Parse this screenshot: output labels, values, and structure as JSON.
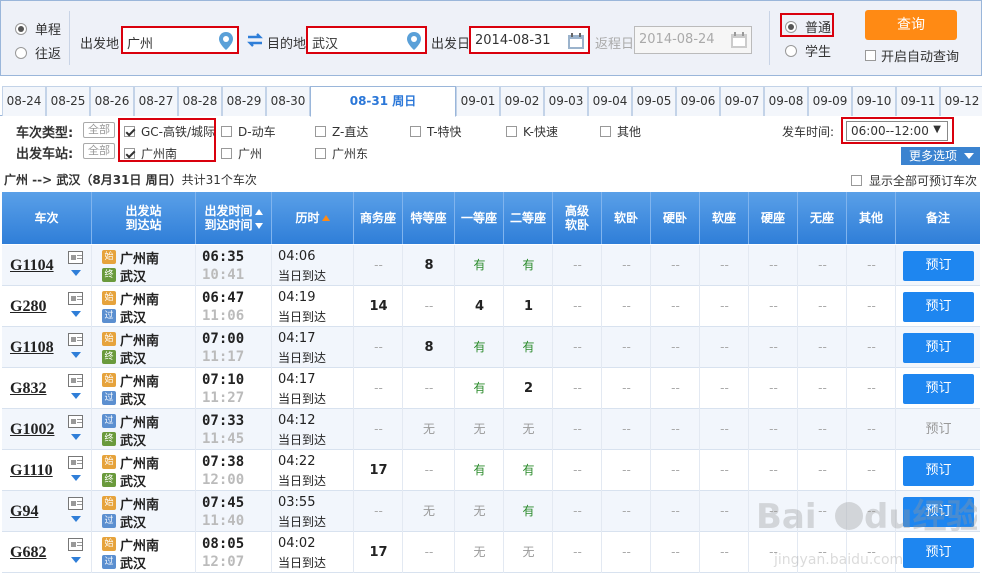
{
  "query": {
    "trip_types": [
      {
        "label": "单程",
        "selected": true
      },
      {
        "label": "往返",
        "selected": false
      }
    ],
    "from_label": "出发地",
    "from_value": "广州",
    "to_label": "目的地",
    "to_value": "武汉",
    "depart_label": "出发日",
    "depart_value": "2014-08-31",
    "return_label": "返程日",
    "return_value": "2014-08-24",
    "passenger_types": [
      {
        "label": "普通",
        "selected": true
      },
      {
        "label": "学生",
        "selected": false
      }
    ],
    "query_button": "查询",
    "auto_query_label": "开启自动查询"
  },
  "date_tabs": [
    "08-24",
    "08-25",
    "08-26",
    "08-27",
    "08-28",
    "08-29",
    "08-30",
    "08-31 周日",
    "09-01",
    "09-02",
    "09-03",
    "09-04",
    "09-05",
    "09-06",
    "09-07",
    "09-08",
    "09-09",
    "09-10",
    "09-11",
    "09-12"
  ],
  "active_date_index": 7,
  "filters": {
    "type_label": "车次类型:",
    "station_label": "出发车站:",
    "all_label": "全部",
    "types": [
      {
        "label": "GC-高铁/城际",
        "checked": true
      },
      {
        "label": "D-动车",
        "checked": false
      },
      {
        "label": "Z-直达",
        "checked": false
      },
      {
        "label": "T-特快",
        "checked": false
      },
      {
        "label": "K-快速",
        "checked": false
      },
      {
        "label": "其他",
        "checked": false
      }
    ],
    "stations": [
      {
        "label": "广州南",
        "checked": true
      },
      {
        "label": "广州",
        "checked": false
      },
      {
        "label": "广州东",
        "checked": false
      }
    ],
    "dep_time_label": "发车时间:",
    "dep_time_value": "06:00--12:00",
    "more_label": "更多选项"
  },
  "summary": {
    "route": "广州 --> 武汉（8月31日  周日）",
    "count": "共计31个车次",
    "show_all_label": "显示全部可预订车次"
  },
  "headers": {
    "train": "车次",
    "station_1": "出发站",
    "station_2": "到达站",
    "time_1": "出发时间",
    "time_2": "到达时间",
    "duration": "历时",
    "business": "商务座",
    "special": "特等座",
    "first": "一等座",
    "second": "二等座",
    "adv_soft_1": "高级",
    "adv_soft_2": "软卧",
    "soft_sleeper": "软卧",
    "hard_sleeper": "硬卧",
    "soft_seat": "软座",
    "hard_seat": "硬座",
    "no_seat": "无座",
    "other": "其他",
    "remark": "备注"
  },
  "badges": {
    "start": "始",
    "pass": "过",
    "end": "终"
  },
  "book_label": "预订",
  "rows": [
    {
      "no": "G1104",
      "from": "广州南",
      "from_type": "start",
      "to": "武汉",
      "to_type": "end",
      "dep": "06:35",
      "arr": "10:41",
      "dur": "04:06",
      "arrival_day": "当日到达",
      "seats": [
        "--",
        "8",
        "有",
        "有",
        "--",
        "--",
        "--",
        "--",
        "--",
        "--",
        "--"
      ],
      "bookable": true
    },
    {
      "no": "G280",
      "from": "广州南",
      "from_type": "start",
      "to": "武汉",
      "to_type": "pass",
      "dep": "06:47",
      "arr": "11:06",
      "dur": "04:19",
      "arrival_day": "当日到达",
      "seats": [
        "14",
        "--",
        "4",
        "1",
        "--",
        "--",
        "--",
        "--",
        "--",
        "--",
        "--"
      ],
      "bookable": true
    },
    {
      "no": "G1108",
      "from": "广州南",
      "from_type": "start",
      "to": "武汉",
      "to_type": "end",
      "dep": "07:00",
      "arr": "11:17",
      "dur": "04:17",
      "arrival_day": "当日到达",
      "seats": [
        "--",
        "8",
        "有",
        "有",
        "--",
        "--",
        "--",
        "--",
        "--",
        "--",
        "--"
      ],
      "bookable": true
    },
    {
      "no": "G832",
      "from": "广州南",
      "from_type": "start",
      "to": "武汉",
      "to_type": "pass",
      "dep": "07:10",
      "arr": "11:27",
      "dur": "04:17",
      "arrival_day": "当日到达",
      "seats": [
        "--",
        "--",
        "有",
        "2",
        "--",
        "--",
        "--",
        "--",
        "--",
        "--",
        "--"
      ],
      "bookable": true
    },
    {
      "no": "G1002",
      "from": "广州南",
      "from_type": "pass",
      "to": "武汉",
      "to_type": "end",
      "dep": "07:33",
      "arr": "11:45",
      "dur": "04:12",
      "arrival_day": "当日到达",
      "seats": [
        "--",
        "无",
        "无",
        "无",
        "--",
        "--",
        "--",
        "--",
        "--",
        "--",
        "--"
      ],
      "bookable": false
    },
    {
      "no": "G1110",
      "from": "广州南",
      "from_type": "start",
      "to": "武汉",
      "to_type": "end",
      "dep": "07:38",
      "arr": "12:00",
      "dur": "04:22",
      "arrival_day": "当日到达",
      "seats": [
        "17",
        "--",
        "有",
        "有",
        "--",
        "--",
        "--",
        "--",
        "--",
        "--",
        "--"
      ],
      "bookable": true
    },
    {
      "no": "G94",
      "from": "广州南",
      "from_type": "start",
      "to": "武汉",
      "to_type": "pass",
      "dep": "07:45",
      "arr": "11:40",
      "dur": "03:55",
      "arrival_day": "当日到达",
      "seats": [
        "--",
        "无",
        "无",
        "有",
        "--",
        "--",
        "--",
        "--",
        "--",
        "--",
        "--"
      ],
      "bookable": true
    },
    {
      "no": "G682",
      "from": "广州南",
      "from_type": "start",
      "to": "武汉",
      "to_type": "pass",
      "dep": "08:05",
      "arr": "12:07",
      "dur": "04:02",
      "arrival_day": "当日到达",
      "seats": [
        "17",
        "--",
        "无",
        "无",
        "--",
        "--",
        "--",
        "--",
        "--",
        "--",
        "--"
      ],
      "bookable": true
    }
  ],
  "watermark": "Baidu经验 jingyan.baidu.com",
  "colors": {
    "accent": "#2f7ed8",
    "highlight_border": "#d9000d",
    "query_button": "#ff8a14",
    "have_seat": "#2a8a2a"
  }
}
